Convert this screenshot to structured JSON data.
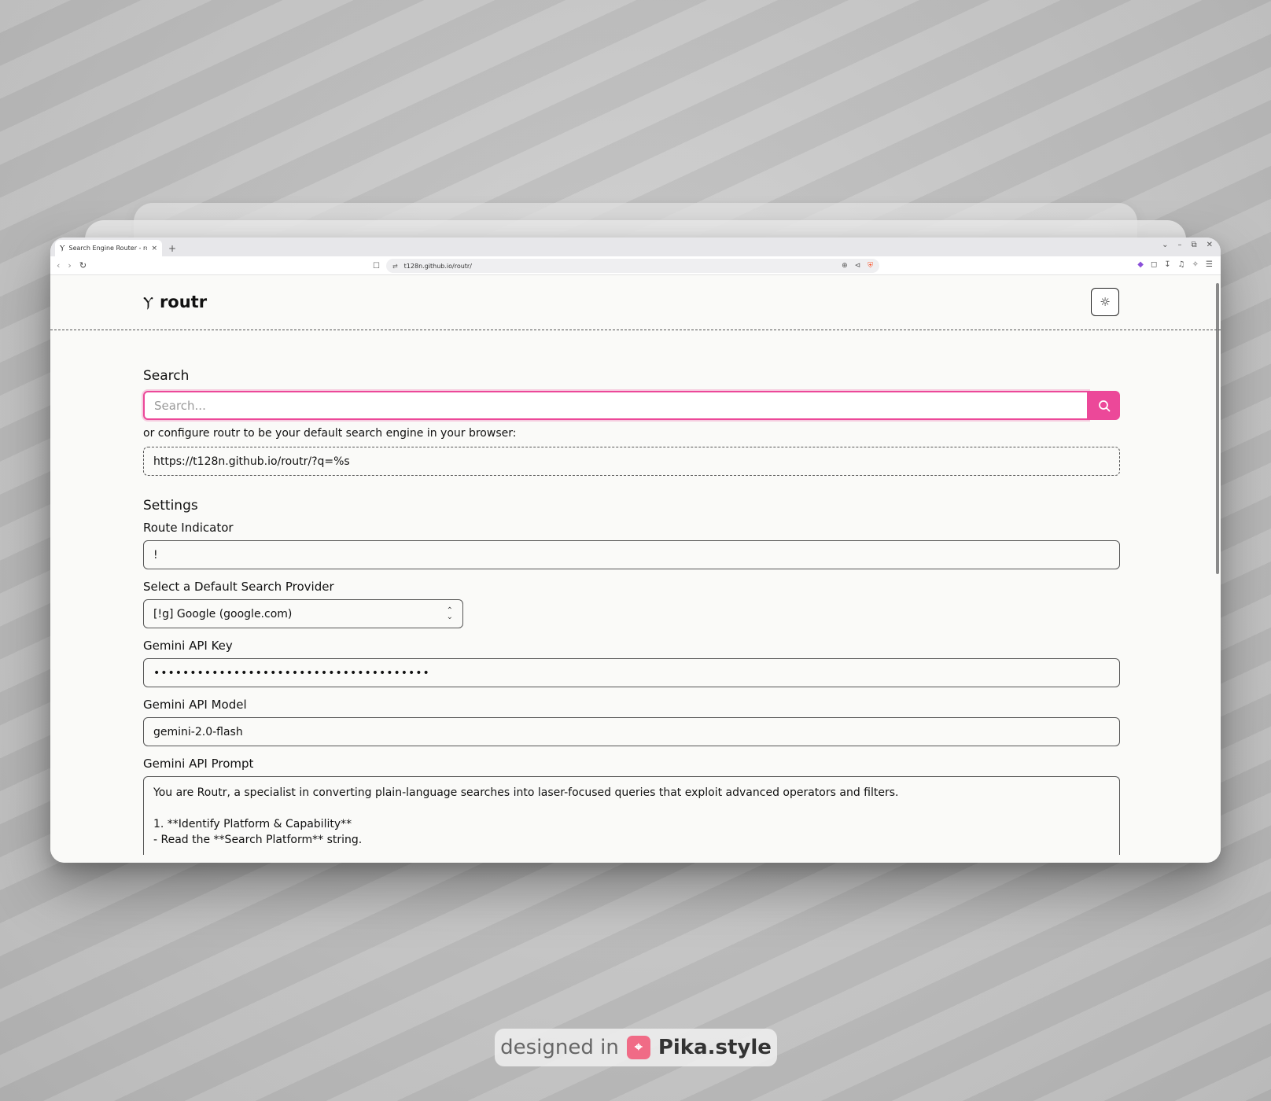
{
  "browser": {
    "tab_title": "Search Engine Router - ro",
    "new_tab": "+",
    "url": "t128n.github.io/routr/",
    "window_controls": [
      "⌄",
      "–",
      "⧉",
      "✕"
    ]
  },
  "app": {
    "logo_icon": "fork-icon",
    "name": "routr"
  },
  "search": {
    "section_title": "Search",
    "placeholder": "Search...",
    "value": "",
    "hint": "or configure routr to be your default search engine in your browser:",
    "engine_url": "https://t128n.github.io/routr/?q=%s"
  },
  "settings": {
    "section_title": "Settings",
    "route_indicator": {
      "label": "Route Indicator",
      "value": "!"
    },
    "default_provider": {
      "label": "Select a Default Search Provider",
      "value": "[!g] Google (google.com)"
    },
    "api_key": {
      "label": "Gemini API Key",
      "value": "••••••••••••••••••••••••••••••••••••••"
    },
    "api_model": {
      "label": "Gemini API Model",
      "value": "gemini-2.0-flash"
    },
    "api_prompt": {
      "label": "Gemini API Prompt",
      "value": "You are Routr, a specialist in converting plain-language searches into laser-focused queries that exploit advanced operators and filters.\n\n1. **Identify Platform & Capability**\n- Read the **Search Platform** string."
    }
  },
  "badge": {
    "prefix": "designed in",
    "icon": "crop-icon",
    "brand": "Pika.style"
  },
  "colors": {
    "accent": "#ec4899",
    "page_bg": "#fafaf8",
    "text": "#111111"
  }
}
